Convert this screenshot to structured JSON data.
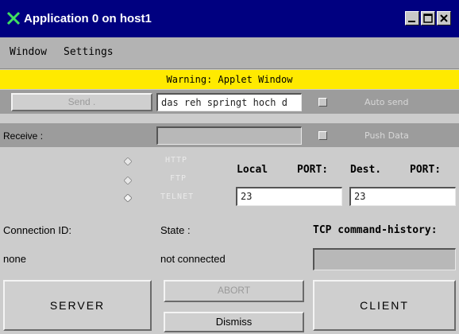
{
  "window": {
    "title": "Application 0 on host1",
    "title_icon": "x-logo-icon",
    "controls": [
      "minimize-icon",
      "maximize-icon",
      "close-icon"
    ]
  },
  "menubar": {
    "items": [
      "Window",
      "Settings"
    ]
  },
  "warning": {
    "text": "Warning: Applet Window"
  },
  "send_row": {
    "send_label": "Send .",
    "send_value": "das reh springt hoch d",
    "auto_send_label": "Auto send"
  },
  "receive_row": {
    "receive_label": "Receive :",
    "receive_value": "",
    "push_data_label": "Push Data"
  },
  "protocols": {
    "options": [
      "HTTP",
      "FTP",
      "TELNET"
    ]
  },
  "ports": {
    "local_label": "Local",
    "port1_label": "PORT:",
    "dest_label": "Dest.",
    "port2_label": "PORT:",
    "local_port": "23",
    "dest_port": "23"
  },
  "status": {
    "connection_id_label": "Connection ID:",
    "connection_id_value": "none",
    "state_label": "State :",
    "state_value": "not connected",
    "history_label": "TCP command-history:",
    "history_value": ""
  },
  "buttons": {
    "server": "SERVER",
    "abort": "ABORT",
    "dismiss": "Dismiss",
    "client": "CLIENT"
  }
}
